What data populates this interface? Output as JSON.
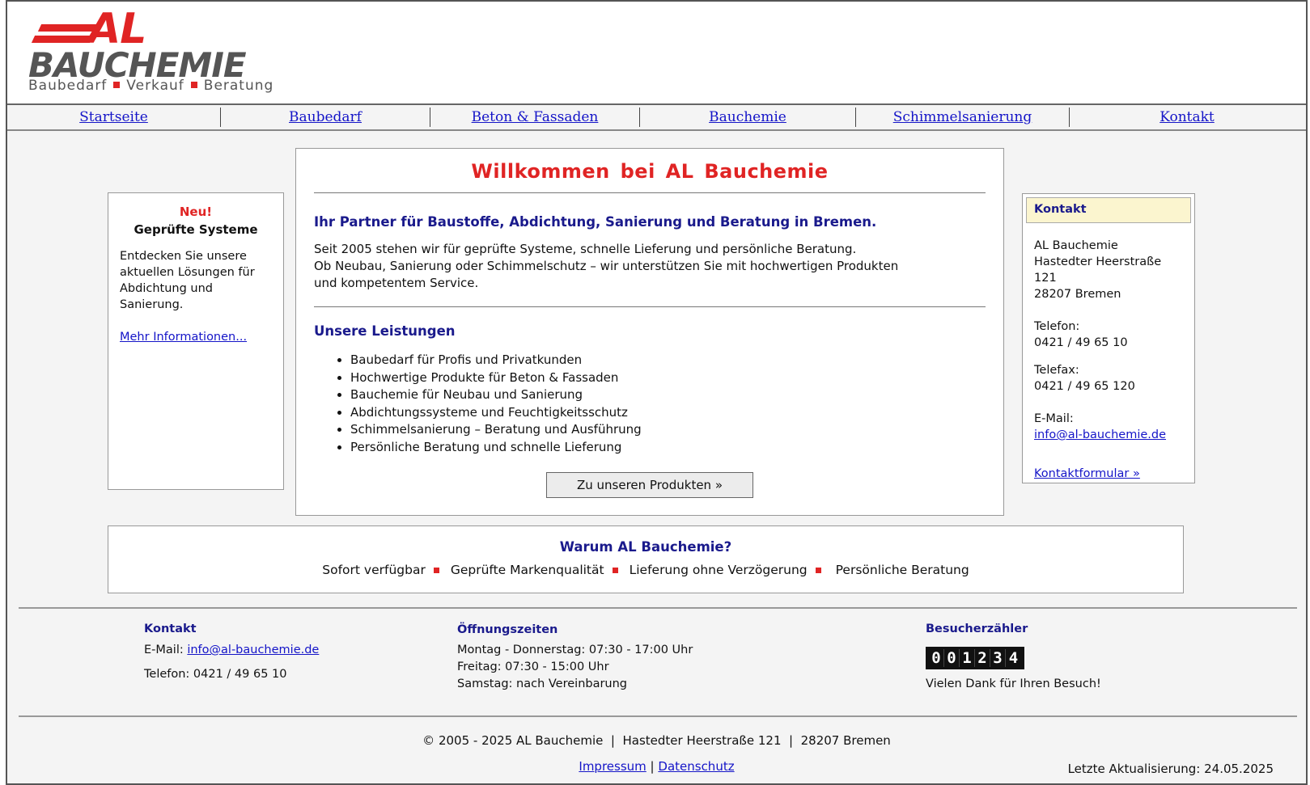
{
  "logo": {
    "line1": "AL",
    "line2": "BAUCHEMIE",
    "tagline": [
      "Baubedarf",
      "Verkauf",
      "Beratung"
    ],
    "accent_color": "#e02424"
  },
  "nav": {
    "items": [
      "Startseite",
      "Baubedarf",
      "Beton & Fassaden",
      "Bauchemie",
      "Schimmelsanierung",
      "Kontakt"
    ]
  },
  "left_box": {
    "badge": "Neu!",
    "title": "Geprüfte Systeme",
    "text": "Entdecken Sie unsere aktuellen Lösungen für Abdichtung und Sanierung.",
    "link": "Mehr Informationen..."
  },
  "main": {
    "title": "Willkommen bei AL Bauchemie",
    "subtitle": "Ihr Partner für Baustoffe, Abdichtung, Sanierung und Beratung in Bremen.",
    "intro_line1": "Seit 2005 stehen wir für geprüfte Systeme, schnelle Lieferung und persönliche Beratung.",
    "intro_line2": "Ob Neubau, Sanierung oder Schimmelschutz – wir unterstützen Sie mit hochwertigen Produkten",
    "intro_line3": "und kompetentem Service.",
    "services_heading": "Unsere Leistungen",
    "services": [
      "Baubedarf für Profis und Privatkunden",
      "Hochwertige Produkte für Beton & Fassaden",
      "Bauchemie für Neubau und Sanierung",
      "Abdichtungssysteme und Feuchtigkeitsschutz",
      "Schimmelsanierung – Beratung und Ausführung",
      "Persönliche Beratung und schnelle Lieferung"
    ],
    "button": "Zu unseren Produkten »"
  },
  "contact_box": {
    "heading": "Kontakt",
    "name": "AL Bauchemie",
    "street": "Hastedter Heerstraße 121",
    "city": "28207 Bremen",
    "phone_label": "Telefon:",
    "phone": "0421 / 49 65 10",
    "fax_label": "Telefax:",
    "fax": "0421 / 49 65 120",
    "email_label": "E-Mail:",
    "email": "info@al-bauchemie.de",
    "form_link": "Kontaktformular »"
  },
  "why": {
    "heading": "Warum AL Bauchemie?",
    "features": [
      "Sofort verfügbar",
      "Geprüfte Markenqualität",
      "Lieferung ohne Verzögerung",
      "Persönliche Beratung"
    ]
  },
  "footer": {
    "contact_title": "Kontakt",
    "email_label": "E-Mail:",
    "email": "info@al-bauchemie.de",
    "phone": "Telefon: 0421 / 49 65 10",
    "hours_title": "Öffnungszeiten",
    "hours": [
      "Montag - Donnerstag: 07:30 - 17:00 Uhr",
      "Freitag: 07:30 - 15:00 Uhr",
      "Samstag: nach Vereinbarung"
    ],
    "counter_title": "Besucherzähler",
    "counter_digits": [
      "0",
      "0",
      "1",
      "2",
      "3",
      "4"
    ],
    "thanks": "Vielen Dank für Ihren Besuch!",
    "copyright": "© 2005 - 2025 AL Bauchemie  |  Hastedter Heerstraße 121  |  28207 Bremen",
    "impressum": "Impressum",
    "separator": "|",
    "datenschutz": "Datenschutz",
    "updated": "Letzte Aktualisierung: 24.05.2025"
  }
}
